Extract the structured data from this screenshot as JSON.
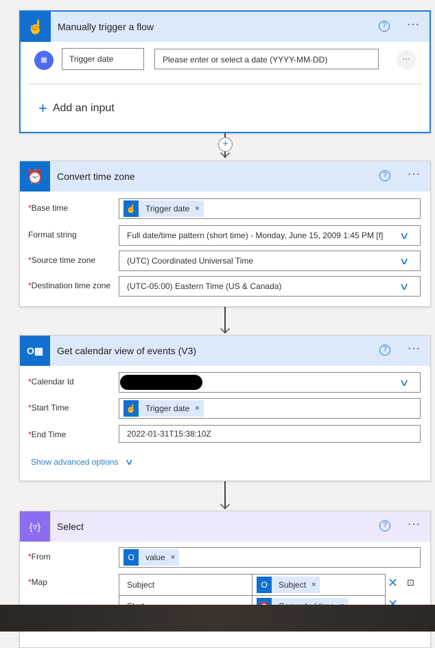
{
  "trigger": {
    "title": "Manually trigger a flow",
    "input_name": "Trigger date",
    "input_placeholder": "Please enter or select a date (YYYY-MM-DD)",
    "add_input": "Add an input",
    "accent": "#1170cf"
  },
  "convert": {
    "title": "Convert time zone",
    "fields": [
      {
        "label": "Base time",
        "required": true,
        "token": "Trigger date"
      },
      {
        "label": "Format string",
        "required": false,
        "value": "Full date/time pattern (short time) - Monday, June 15, 2009 1:45 PM [f]"
      },
      {
        "label": "Source time zone",
        "required": true,
        "value": "(UTC) Coordinated Universal Time"
      },
      {
        "label": "Destination time zone",
        "required": true,
        "value": "(UTC-05:00) Eastern Time (US & Canada)"
      }
    ]
  },
  "calendar": {
    "title": "Get calendar view of events (V3)",
    "fields": [
      {
        "label": "Calendar Id",
        "required": true
      },
      {
        "label": "Start Time",
        "required": true,
        "token": "Trigger date"
      },
      {
        "label": "End Time",
        "required": true,
        "value": "2022-01-31T15:38:10Z"
      }
    ],
    "advanced": "Show advanced options"
  },
  "select": {
    "title": "Select",
    "from_label": "From",
    "from_token": "value",
    "map_label": "Map",
    "map": [
      {
        "key": "Subject",
        "token": "Subject"
      },
      {
        "key": "Start",
        "token": "Converted time"
      }
    ],
    "accent": "#8c6cf0"
  },
  "required_mark": "*",
  "remove": "×"
}
